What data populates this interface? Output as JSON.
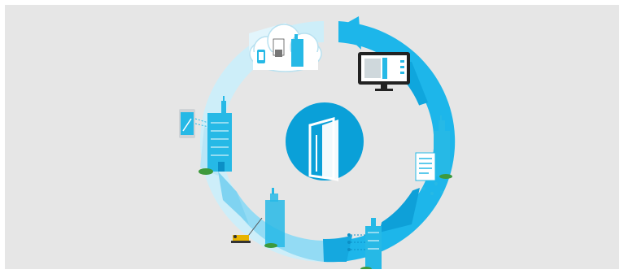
{
  "colors": {
    "background": "#e6e6e6",
    "ring_light": "#c7ebf8",
    "ring_mid": "#8fd8f3",
    "ring_accent": "#1bb3e8",
    "ring_dark": "#0aa0d8",
    "center_badge": "#0aa0d8",
    "building": "#26b9e6",
    "building_dark": "#0b8fc6",
    "bush": "#3d9a3d",
    "crane": "#e8b400"
  },
  "diagram": {
    "center_icon": "door-icon",
    "stages": [
      {
        "id": "cloud-documents",
        "icon": "cloud-icon"
      },
      {
        "id": "monitor-dashboard",
        "icon": "monitor-icon"
      },
      {
        "id": "document-network",
        "icon": "document-icon"
      },
      {
        "id": "network-building",
        "icon": "building-icon"
      },
      {
        "id": "construction",
        "icon": "crane-icon"
      },
      {
        "id": "tablet-building",
        "icon": "tablet-icon"
      }
    ]
  }
}
